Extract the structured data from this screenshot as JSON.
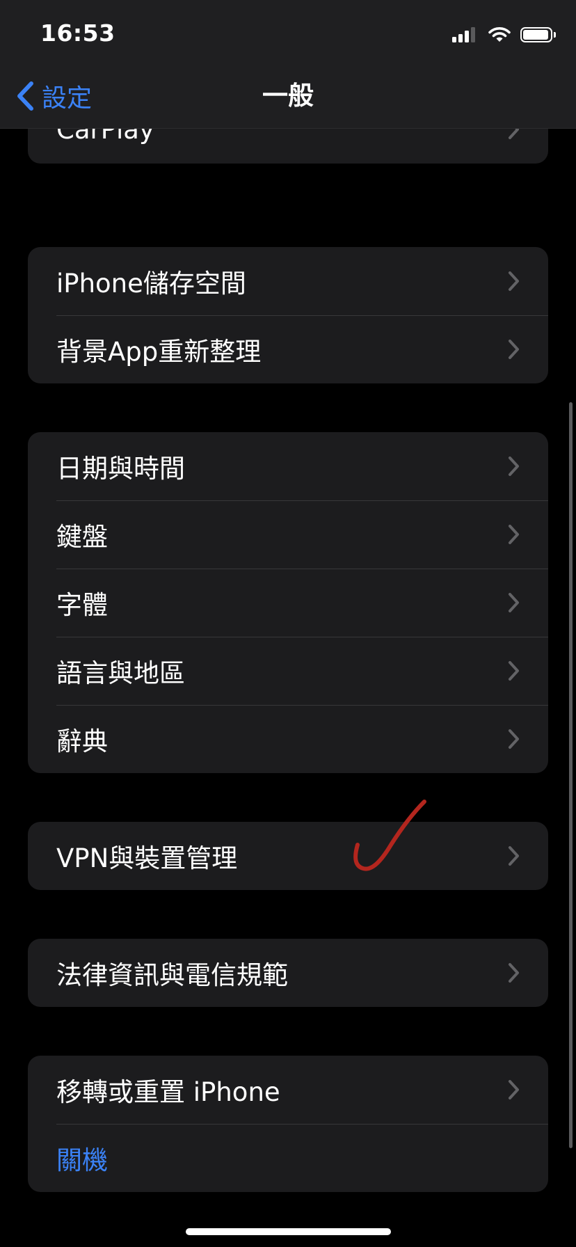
{
  "status_bar": {
    "time": "16:53"
  },
  "nav": {
    "back_label": "設定",
    "title": "一般"
  },
  "groups": [
    {
      "items": [
        {
          "label": "CarPlay"
        }
      ]
    },
    {
      "items": [
        {
          "label": "iPhone儲存空間"
        },
        {
          "label": "背景App重新整理"
        }
      ]
    },
    {
      "items": [
        {
          "label": "日期與時間"
        },
        {
          "label": "鍵盤"
        },
        {
          "label": "字體"
        },
        {
          "label": "語言與地區"
        },
        {
          "label": "辭典"
        }
      ]
    },
    {
      "items": [
        {
          "label": "VPN與裝置管理"
        }
      ]
    },
    {
      "items": [
        {
          "label": "法律資訊與電信規範"
        }
      ]
    },
    {
      "items": [
        {
          "label": "移轉或重置 iPhone"
        },
        {
          "label": "關機"
        }
      ]
    }
  ],
  "colors": {
    "accent": "#3b82f6",
    "background": "#000000",
    "group_background": "#1c1c1e",
    "annotation": "#b3261e"
  },
  "icons": {
    "back": "chevron-left-icon",
    "row": "chevron-right-icon",
    "wifi": "wifi-icon",
    "signal": "cellular-signal-icon",
    "battery": "battery-icon"
  }
}
